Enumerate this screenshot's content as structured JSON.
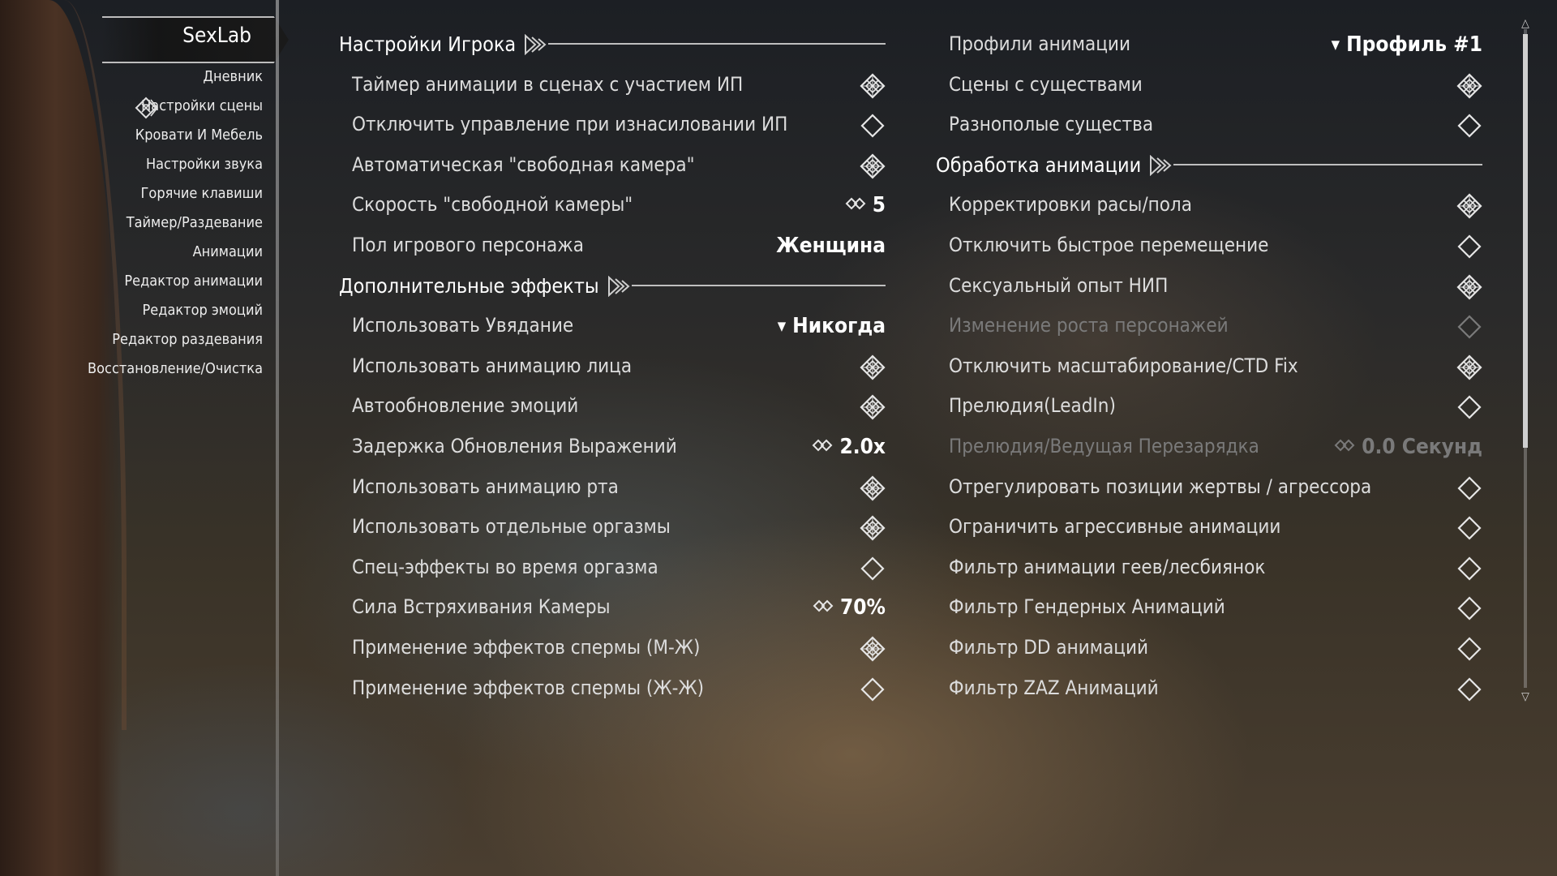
{
  "sidebar": {
    "mod_title": "SexLab",
    "items": [
      {
        "label": "Дневник",
        "selected": false
      },
      {
        "label": "Настройки сцены",
        "selected": true
      },
      {
        "label": "Кровати И Мебель",
        "selected": false
      },
      {
        "label": "Настройки звука",
        "selected": false
      },
      {
        "label": "Горячие клавиши",
        "selected": false
      },
      {
        "label": "Таймер/Раздевание",
        "selected": false
      },
      {
        "label": "Анимации",
        "selected": false
      },
      {
        "label": "Редактор анимации",
        "selected": false
      },
      {
        "label": "Редактор эмоций",
        "selected": false
      },
      {
        "label": "Редактор раздевания",
        "selected": false
      },
      {
        "label": "Восстановление/Очистка",
        "selected": false
      }
    ]
  },
  "left_column": [
    {
      "type": "header",
      "label": "Настройки Игрока"
    },
    {
      "type": "toggle",
      "label": "Таймер анимации в сценах с участием ИП",
      "checked": true
    },
    {
      "type": "toggle",
      "label": "Отключить управление при изнасиловании ИП",
      "checked": false
    },
    {
      "type": "toggle",
      "label": "Автоматическая \"свободная камера\"",
      "checked": true
    },
    {
      "type": "slider",
      "label": "Скорость \"свободной камеры\"",
      "value": "5"
    },
    {
      "type": "text",
      "label": "Пол игрового персонажа",
      "value": "Женщина"
    },
    {
      "type": "header",
      "label": "Дополнительные эффекты"
    },
    {
      "type": "menu",
      "label": "Использовать Увядание",
      "value": "Никогда"
    },
    {
      "type": "toggle",
      "label": "Использовать анимацию лица",
      "checked": true
    },
    {
      "type": "toggle",
      "label": "Автообновление эмоций",
      "checked": true
    },
    {
      "type": "slider",
      "label": "Задержка Обновления Выражений",
      "value": "2.0x"
    },
    {
      "type": "toggle",
      "label": "Использовать анимацию рта",
      "checked": true
    },
    {
      "type": "toggle",
      "label": "Использовать отдельные оргазмы",
      "checked": true
    },
    {
      "type": "toggle",
      "label": "Спец-эффекты во время оргазма",
      "checked": false
    },
    {
      "type": "slider",
      "label": "Сила Встряхивания Камеры",
      "value": "70%"
    },
    {
      "type": "toggle",
      "label": "Применение эффектов спермы (М-Ж)",
      "checked": true
    },
    {
      "type": "toggle",
      "label": "Применение эффектов спермы (Ж-Ж)",
      "checked": false
    }
  ],
  "right_column": [
    {
      "type": "menu",
      "label": "Профили анимации",
      "value": "Профиль #1"
    },
    {
      "type": "toggle",
      "label": "Сцены с существами",
      "checked": true
    },
    {
      "type": "toggle",
      "label": "Разнополые существа",
      "checked": false
    },
    {
      "type": "header",
      "label": "Обработка анимации"
    },
    {
      "type": "toggle",
      "label": "Корректировки расы/пола",
      "checked": true
    },
    {
      "type": "toggle",
      "label": "Отключить быстрое перемещение",
      "checked": false
    },
    {
      "type": "toggle",
      "label": "Сексуальный опыт НИП",
      "checked": true
    },
    {
      "type": "toggle",
      "label": "Изменение роста персонажей",
      "checked": false,
      "disabled": true
    },
    {
      "type": "toggle",
      "label": "Отключить масштабирование/CTD Fix",
      "checked": true
    },
    {
      "type": "toggle",
      "label": "Прелюдия(LeadIn)",
      "checked": false
    },
    {
      "type": "slider",
      "label": "Прелюдия/Ведущая Перезарядка",
      "value": "0.0 Секунд",
      "disabled": true
    },
    {
      "type": "toggle",
      "label": "Отрегулировать позиции жертвы / агрессора",
      "checked": false
    },
    {
      "type": "toggle",
      "label": "Ограничить агрессивные анимации",
      "checked": false
    },
    {
      "type": "toggle",
      "label": "Фильтр анимации геев/лесбиянок",
      "checked": false
    },
    {
      "type": "toggle",
      "label": "Фильтр Гендерных Анимаций",
      "checked": false
    },
    {
      "type": "toggle",
      "label": "Фильтр DD анимаций",
      "checked": false
    },
    {
      "type": "toggle",
      "label": "Фильтр ZAZ Анимаций",
      "checked": false
    }
  ],
  "icons": {
    "checked": "checkbox-checked-icon",
    "unchecked": "checkbox-unchecked-icon",
    "slider": "slider-icon",
    "menu": "dropdown-arrow-icon",
    "header": "section-ornament-icon",
    "selected_item": "selection-ornament-icon"
  },
  "colors": {
    "text": "#dcdcdc",
    "value": "#ffffff",
    "disabled": "#7a7a7a",
    "rule": "#bfbfbf"
  }
}
